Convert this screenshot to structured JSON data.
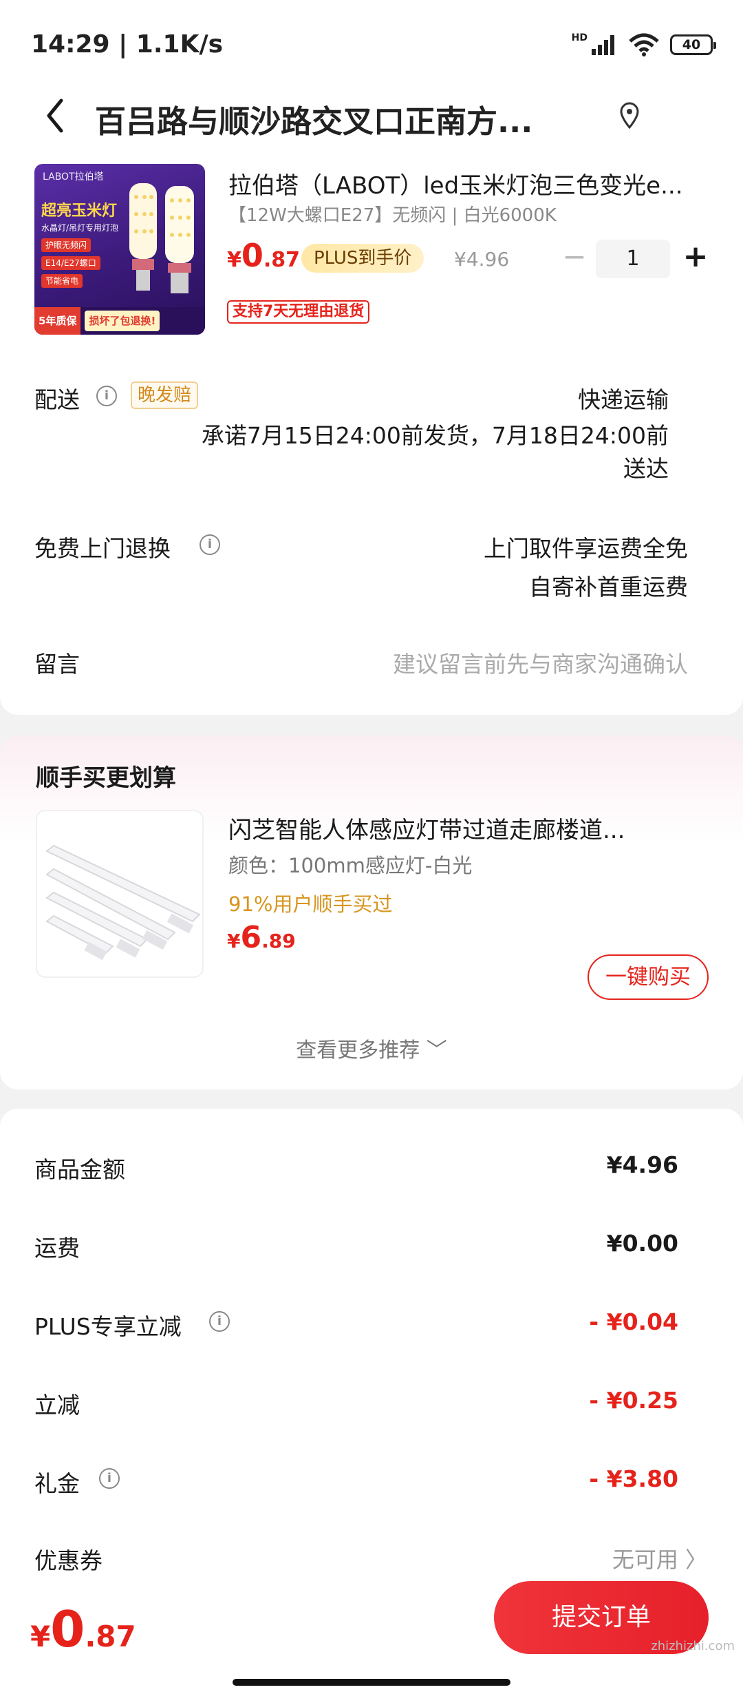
{
  "status_bar": {
    "time": "14:29 | 1.1K/s",
    "hd": "HD",
    "battery": "40"
  },
  "header": {
    "title": "百吕路与顺沙路交叉口正南方..."
  },
  "product": {
    "image": {
      "brand": "LABOT拉伯塔",
      "title": "超亮玉米灯",
      "sub": "水晶灯/吊灯专用灯泡",
      "tags": [
        "护眼无频闪",
        "E14/E27螺口",
        "节能省电"
      ],
      "warranty": "5年质保",
      "promise": "损坏了包退换!"
    },
    "name": "拉伯塔（LABOT）led玉米灯泡三色变光e...",
    "spec": "【12W大螺口E27】无频闪 | 白光6000K",
    "price_currency": "¥",
    "price_int": "0",
    "price_dec": ".87",
    "plus_tag": "PLUS到手价",
    "original_price": "¥4.96",
    "qty_minus": "−",
    "quantity": "1",
    "qty_plus": "+",
    "return_badge": "支持7天无理由退货"
  },
  "delivery": {
    "label": "配送",
    "tag": "晚发赔",
    "method": "快递运输",
    "promise_line1": "承诺7月15日24:00前发货，7月18日24:00前",
    "promise_line2": "送达"
  },
  "return_service": {
    "label": "免费上门退换",
    "line1": "上门取件享运费全免",
    "line2": "自寄补首重运费"
  },
  "message": {
    "label": "留言",
    "placeholder": "建议留言前先与商家沟通确认"
  },
  "recommend": {
    "title": "顺手买更划算",
    "item_name": "闪芝智能人体感应灯带过道走廊楼道...",
    "item_spec": "颜色：100mm感应灯-白光",
    "item_bought": "91%用户顺手买过",
    "price_currency": "¥",
    "price_int": "6",
    "price_dec": ".89",
    "buy_label": "一键购买",
    "more_label": "查看更多推荐 ﹀"
  },
  "price_summary": {
    "rows": [
      {
        "label": "商品金额",
        "value": "¥4.96"
      },
      {
        "label": "运费",
        "value": "¥0.00"
      },
      {
        "label": "PLUS专享立减",
        "value": "- ¥0.04"
      },
      {
        "label": "立减",
        "value": "- ¥0.25"
      },
      {
        "label": "礼金",
        "value": "- ¥3.80"
      }
    ],
    "coupon_label": "优惠券",
    "coupon_value": "无可用 〉"
  },
  "bottom_bar": {
    "total_currency": "¥",
    "total_int": "0",
    "total_dec": ".87",
    "submit_label": "提交订单",
    "watermark": "zhizhizhi.com"
  },
  "colors": {
    "accent": "#e5231b",
    "plus_gold": "#ffe8a6",
    "bought_orange": "#d7951f"
  },
  "icons": [
    "back-arrow-icon",
    "location-pin-icon",
    "info-icon",
    "chevron-down-icon",
    "chevron-right-icon",
    "signal-icon",
    "wifi-icon",
    "battery-icon"
  ]
}
